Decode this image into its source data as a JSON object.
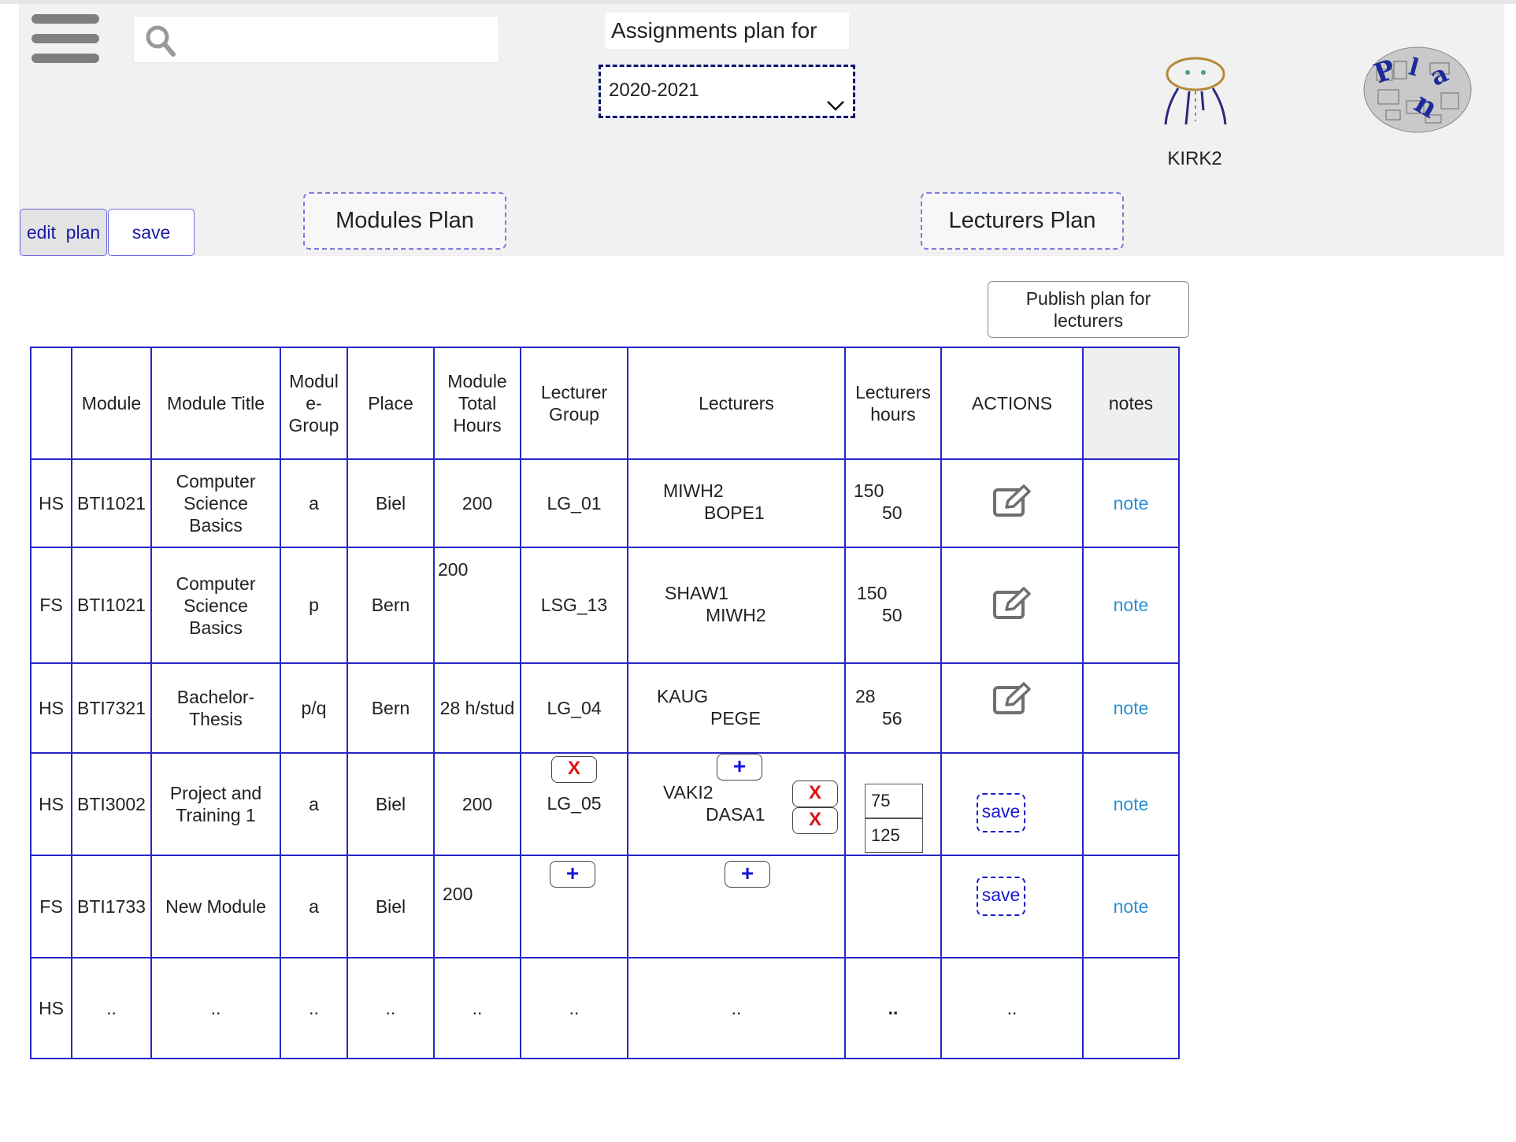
{
  "header": {
    "search_placeholder": "",
    "plan_for_label": "Assignments plan for",
    "year_selected": "2020-2021",
    "username": "KIRK2",
    "logo_text": "Plan"
  },
  "toolbar": {
    "edit_plan_label": "edit  plan",
    "save_label": "save",
    "modules_plan_label": "Modules Plan",
    "lecturers_plan_label": "Lecturers Plan",
    "publish_label_line1": "Publish plan for",
    "publish_label_line2": "lecturers"
  },
  "table": {
    "headers": {
      "semester": "",
      "module": "Module",
      "module_title": "Module Title",
      "module_group_1": "Modul",
      "module_group_2": "e-",
      "module_group_3": "Group",
      "place": "Place",
      "total_hours_1": "Module",
      "total_hours_2": "Total",
      "total_hours_3": "Hours",
      "lecturer_group_1": "Lecturer",
      "lecturer_group_2": "Group",
      "lecturers": "Lecturers",
      "lecturers_hours_1": "Lecturers",
      "lecturers_hours_2": "hours",
      "actions": "ACTIONS",
      "notes": "notes"
    },
    "rows": [
      {
        "semester": "HS",
        "module": "BTI1021",
        "title_1": "Computer",
        "title_2": "Science",
        "title_3": "Basics",
        "group": "a",
        "place": "Biel",
        "total_hours": "200",
        "lecturer_group": "LG_01",
        "lecturer_1": "MIWH2",
        "lecturer_2": "BOPE1",
        "hours_1": "150",
        "hours_2": "50",
        "note": "note"
      },
      {
        "semester": "FS",
        "module": "BTI1021",
        "title_1": "Computer",
        "title_2": "Science",
        "title_3": "Basics",
        "group": "p",
        "place": "Bern",
        "total_hours": "200",
        "lecturer_group": "LSG_13",
        "lecturer_1": "SHAW1",
        "lecturer_2": "MIWH2",
        "hours_1": "150",
        "hours_2": "50",
        "note": "note"
      },
      {
        "semester": "HS",
        "module": "BTI7321",
        "title_1": "Bachelor-",
        "title_2": "Thesis",
        "group": "p/q",
        "place": "Bern",
        "total_hours": "28 h/stud",
        "lecturer_group": "LG_04",
        "lecturer_1": "KAUG",
        "lecturer_2": "PEGE",
        "hours_1": "28",
        "hours_2": "56",
        "note": "note"
      },
      {
        "semester": "HS",
        "module": "BTI3002",
        "title_1": "Project and",
        "title_2": "Training 1",
        "group": "a",
        "place": "Biel",
        "total_hours": "200",
        "lecturer_group": "LG_05",
        "lecturer_1": "VAKI2",
        "lecturer_2": "DASA1",
        "hours_1": "75",
        "hours_2": "125",
        "remove_label": "X",
        "add_label": "+",
        "save_label": "save",
        "note": "note"
      },
      {
        "semester": "FS",
        "module": "BTI1733",
        "title_1": "New Module",
        "group": "a",
        "place": "Biel",
        "total_hours": "200",
        "add_label": "+",
        "save_label": "save",
        "note": "note"
      },
      {
        "semester": "HS",
        "module": "..",
        "title_1": "..",
        "group": "..",
        "place": "..",
        "total_hours": "..",
        "lecturer_group": "..",
        "lecturers": "..",
        "hours": "..",
        "actions": ".."
      }
    ]
  }
}
